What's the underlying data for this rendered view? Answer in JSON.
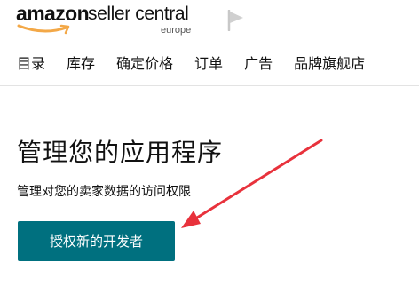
{
  "header": {
    "logo": {
      "brand": "amazon",
      "product": "seller central",
      "region": "europe"
    },
    "flag_icon": "flag-icon"
  },
  "nav": {
    "items": [
      {
        "label": "目录"
      },
      {
        "label": "库存"
      },
      {
        "label": "确定价格"
      },
      {
        "label": "订单"
      },
      {
        "label": "广告"
      },
      {
        "label": "品牌旗舰店"
      }
    ]
  },
  "main": {
    "title": "管理您的应用程序",
    "description": "管理对您的卖家数据的访问权限",
    "button_label": "授权新的开发者"
  },
  "colors": {
    "button": "#00707f",
    "annotation_arrow": "#e8323c"
  }
}
